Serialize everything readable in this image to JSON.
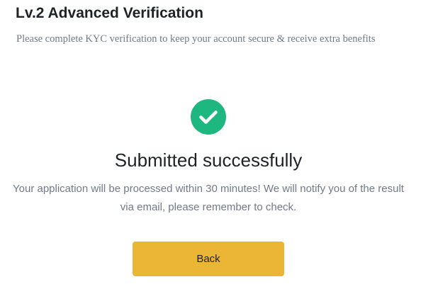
{
  "header": {
    "title": "Lv.2 Advanced Verification",
    "subtitle": "Please complete KYC verification to keep your account secure & receive extra benefits"
  },
  "status": {
    "icon": "check-circle-icon",
    "icon_color": "#1fb780",
    "title": "Submitted successfully",
    "message": "Your application will be processed within 30 minutes! We will notify you of the result via email, please remember to check."
  },
  "actions": {
    "back_label": "Back",
    "button_color": "#ebb535"
  }
}
